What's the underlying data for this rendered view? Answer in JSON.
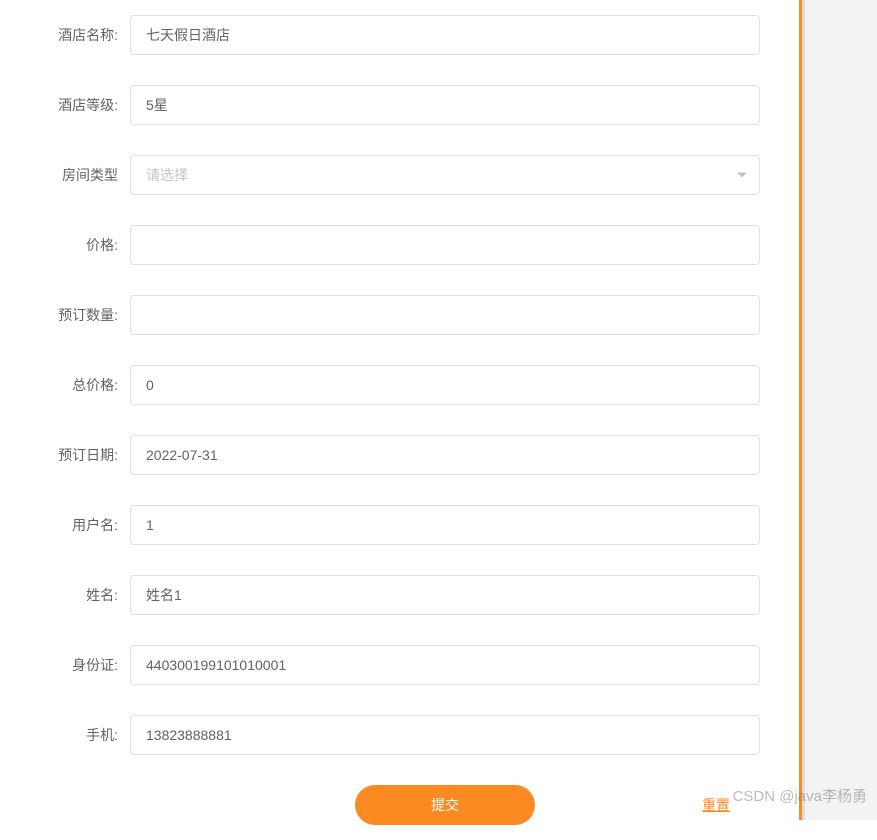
{
  "form": {
    "hotelName": {
      "label": "酒店名称:",
      "value": "七天假日酒店"
    },
    "hotelLevel": {
      "label": "酒店等级:",
      "value": "5星"
    },
    "roomType": {
      "label": "房间类型",
      "placeholder": "请选择"
    },
    "price": {
      "label": "价格:",
      "value": ""
    },
    "bookQty": {
      "label": "预订数量:",
      "value": ""
    },
    "totalPrice": {
      "label": "总价格:",
      "value": "0"
    },
    "bookDate": {
      "label": "预订日期:",
      "value": "2022-07-31"
    },
    "username": {
      "label": "用户名:",
      "value": "1"
    },
    "name": {
      "label": "姓名:",
      "value": "姓名1"
    },
    "idCard": {
      "label": "身份证:",
      "value": "440300199101010001"
    },
    "phone": {
      "label": "手机:",
      "value": "13823888881"
    }
  },
  "buttons": {
    "submit": "提交",
    "reset": "重置"
  },
  "watermark": "CSDN @java李杨勇"
}
